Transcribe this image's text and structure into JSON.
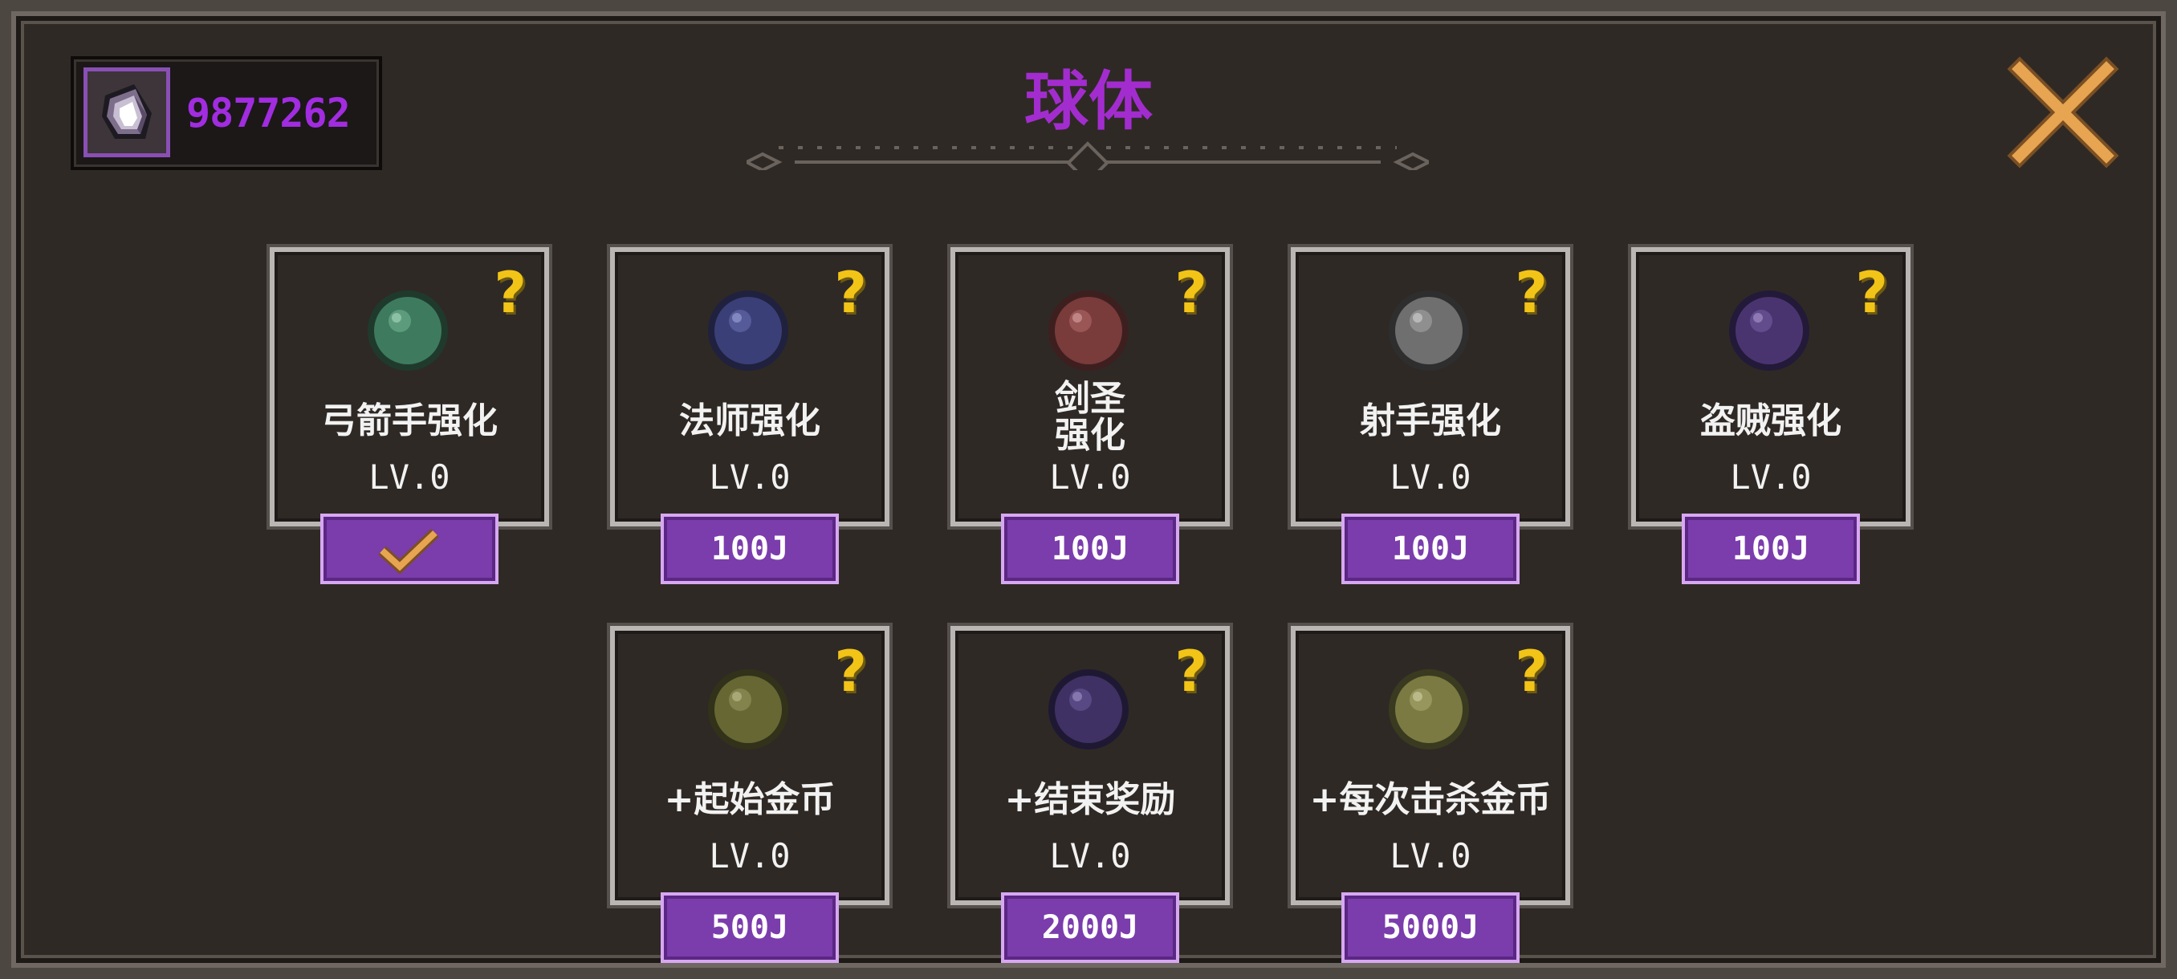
{
  "header": {
    "title": "球体",
    "currency_value": "9877262"
  },
  "colors": {
    "accent": "#a32ccf",
    "button": "#7b3cac",
    "help": "#f2c417",
    "close": "#e2a04a"
  },
  "icons": {
    "currency": "purple-crystal-icon",
    "close": "close-x-icon",
    "help": "question-mark-icon",
    "owned": "check-mark-icon"
  },
  "cards": [
    {
      "name": "弓箭手强化",
      "level": "LV.0",
      "price": "",
      "owned": true,
      "orb_color": "#3e7b5e"
    },
    {
      "name": "法师强化",
      "level": "LV.0",
      "price": "100J",
      "owned": false,
      "orb_color": "#3b3f77"
    },
    {
      "name1": "剑圣",
      "name2": "强化",
      "level": "LV.0",
      "price": "100J",
      "owned": false,
      "orb_color": "#7a3b3b"
    },
    {
      "name": "射手强化",
      "level": "LV.0",
      "price": "100J",
      "owned": false,
      "orb_color": "#6f6f6f"
    },
    {
      "name": "盗贼强化",
      "level": "LV.0",
      "price": "100J",
      "owned": false,
      "orb_color": "#4a3470"
    },
    {
      "name": "+起始金币",
      "level": "LV.0",
      "price": "500J",
      "owned": false,
      "orb_color": "#676734"
    },
    {
      "name": "+结束奖励",
      "level": "LV.0",
      "price": "2000J",
      "owned": false,
      "orb_color": "#3f3164"
    },
    {
      "name": "+每次击杀金币",
      "level": "LV.0",
      "price": "5000J",
      "owned": false,
      "orb_color": "#7a7a42"
    }
  ]
}
